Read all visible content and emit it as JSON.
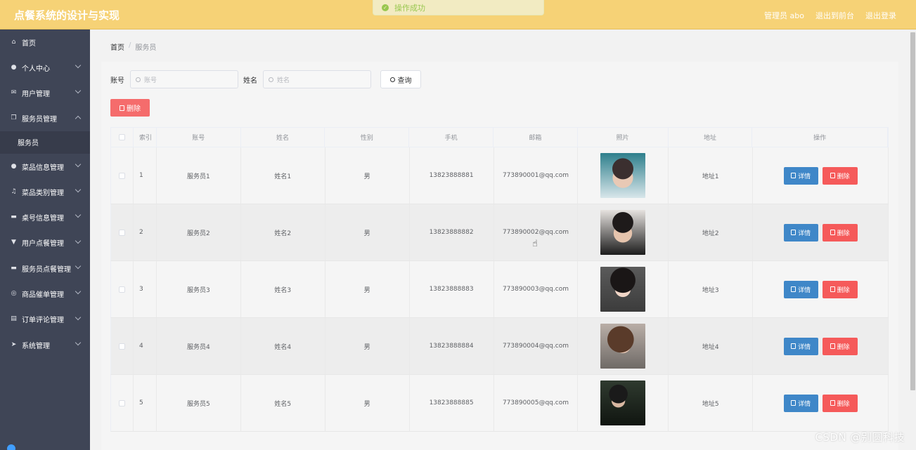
{
  "header": {
    "title": "点餐系统的设计与实现",
    "user_label": "管理员 abo",
    "back_label": "退出到前台",
    "logout_label": "退出登录",
    "toast": "操作成功"
  },
  "sidebar": {
    "items": [
      {
        "label": "首页",
        "icon": "home-icon"
      },
      {
        "label": "个人中心",
        "icon": "user-icon"
      },
      {
        "label": "用户管理",
        "icon": "mail-icon"
      },
      {
        "label": "服务员管理",
        "icon": "copy-icon"
      },
      {
        "label": "菜品信息管理",
        "icon": "location-icon"
      },
      {
        "label": "菜品类别管理",
        "icon": "bell-icon"
      },
      {
        "label": "桌号信息管理",
        "icon": "chat-icon"
      },
      {
        "label": "用户点餐管理",
        "icon": "sign-icon"
      },
      {
        "label": "服务员点餐管理",
        "icon": "monitor-icon"
      },
      {
        "label": "商品催单管理",
        "icon": "globe-icon"
      },
      {
        "label": "订单评论管理",
        "icon": "printer-icon"
      },
      {
        "label": "系统管理",
        "icon": "send-icon"
      }
    ],
    "sub_item": "服务员"
  },
  "breadcrumb": {
    "home": "首页",
    "separator": "/",
    "current": "服务员"
  },
  "search": {
    "account_label": "账号",
    "account_placeholder": "账号",
    "name_label": "姓名",
    "name_placeholder": "姓名",
    "query_label": "查询"
  },
  "delete_label": "删除",
  "table": {
    "headers": [
      "索引",
      "账号",
      "姓名",
      "性别",
      "手机",
      "邮箱",
      "照片",
      "地址",
      "操作"
    ],
    "rows": [
      {
        "index": "1",
        "account": "服务员1",
        "name": "姓名1",
        "gender": "男",
        "phone": "13823888881",
        "email": "773890001@qq.com",
        "address": "地址1"
      },
      {
        "index": "2",
        "account": "服务员2",
        "name": "姓名2",
        "gender": "男",
        "phone": "13823888882",
        "email": "773890002@qq.com",
        "address": "地址2"
      },
      {
        "index": "3",
        "account": "服务员3",
        "name": "姓名3",
        "gender": "男",
        "phone": "13823888883",
        "email": "773890003@qq.com",
        "address": "地址3"
      },
      {
        "index": "4",
        "account": "服务员4",
        "name": "姓名4",
        "gender": "男",
        "phone": "13823888884",
        "email": "773890004@qq.com",
        "address": "地址4"
      },
      {
        "index": "5",
        "account": "服务员5",
        "name": "姓名5",
        "gender": "男",
        "phone": "13823888885",
        "email": "773890005@qq.com",
        "address": "地址5"
      }
    ],
    "detail_label": "详情",
    "delete_label": "删除"
  },
  "watermark": "CSDN @别圆科技",
  "colors": {
    "header": "#f6d276",
    "sidebar": "#3f4556",
    "detail": "#3f87c8",
    "danger": "#f55a5a"
  }
}
